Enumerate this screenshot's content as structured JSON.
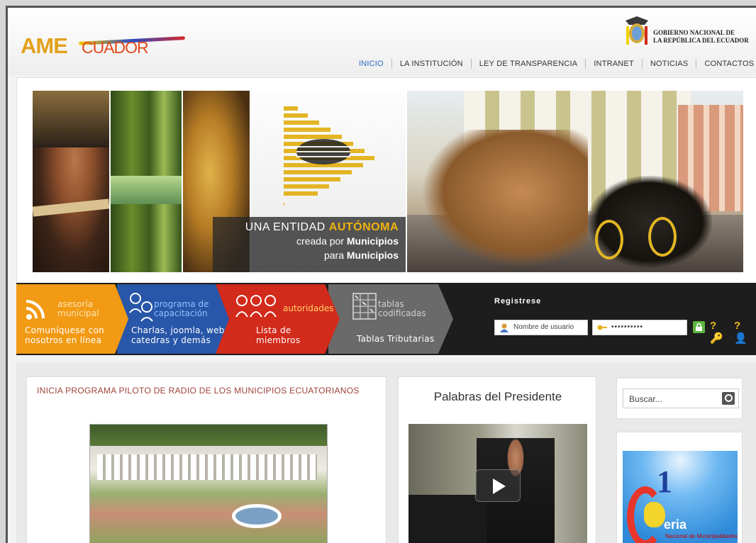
{
  "header": {
    "logo": {
      "part1": "AME",
      "part2": "CUADOR"
    },
    "government": {
      "line1": "GOBIERNO NACIONAL DE",
      "line2": "LA REPÚBLICA DEL ECUADOR"
    },
    "nav": [
      {
        "label": "INICIO",
        "active": true
      },
      {
        "label": "LA INSTITUCIÓN"
      },
      {
        "label": "LEY DE TRANSPARENCIA"
      },
      {
        "label": "INTRANET"
      },
      {
        "label": "NOTICIAS"
      },
      {
        "label": "CONTACTOS"
      }
    ]
  },
  "banner": {
    "tagline_line1_prefix": "UNA ENTIDAD ",
    "tagline_line1_highlight": "AUTÓNOMA",
    "tagline_line2_prefix": "creada por ",
    "tagline_line2_bold": "Municipios",
    "tagline_line3_prefix": "para ",
    "tagline_line3_bold": "Municipios"
  },
  "services": [
    {
      "title1": "asesoría",
      "title2": "municipal",
      "desc1": "Comuníquese con",
      "desc2": "nosotros en línea",
      "color": "#f29a14"
    },
    {
      "title1": "programa de",
      "title2": "capacitación",
      "desc1": "Charlas, joomla, web",
      "desc2": "catedras y demás",
      "color": "#2856a8"
    },
    {
      "title1": "autoridades",
      "desc1": "Lista de",
      "desc2": "miembros",
      "color": "#d22a1b"
    },
    {
      "title1": "tablas",
      "title2": "codificadas",
      "desc1": "Tablas Tributarias",
      "color": "#6a6a6a"
    }
  ],
  "register": {
    "label": "Registrese",
    "username_placeholder": "Nombre de usuario",
    "password_value": "••••••••••"
  },
  "news": {
    "headline": "INICIA PROGRAMA PILOTO DE RADIO DE LOS MUNICIPIOS ECUATORIANOS"
  },
  "president": {
    "heading": "Palabras del Presidente"
  },
  "search": {
    "placeholder": "Buscar..."
  },
  "feria": {
    "num": "1",
    "word": "eria",
    "sub": "Nacional de Municipalidades"
  }
}
